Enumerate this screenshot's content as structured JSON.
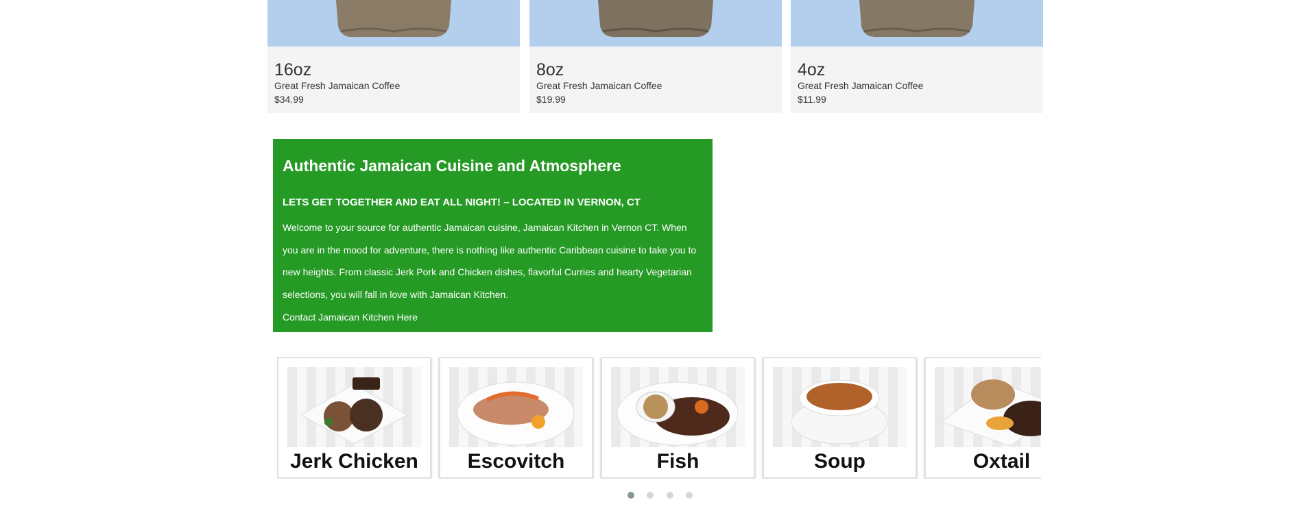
{
  "products": [
    {
      "size": "16oz",
      "description": "Great Fresh Jamaican Coffee",
      "price": "$34.99"
    },
    {
      "size": "8oz",
      "description": "Great Fresh Jamaican Coffee",
      "price": "$19.99"
    },
    {
      "size": "4oz",
      "description": "Great Fresh Jamaican Coffee",
      "price": "$11.99"
    }
  ],
  "about": {
    "title": "Authentic Jamaican Cuisine and Atmosphere",
    "subtitle": "LETS GET TOGETHER AND EAT ALL NIGHT! – LOCATED IN VERNON, CT",
    "body": "Welcome to your source for authentic Jamaican cuisine, Jamaican Kitchen in Vernon CT. When you are in the mood for adventure, there is nothing like authentic Caribbean cuisine to take you to new heights. From classic Jerk Pork and Chicken dishes, flavorful Curries and hearty Vegetarian selections, you will fall in love with Jamaican Kitchen.",
    "contact_link": "Contact Jamaican Kitchen Here"
  },
  "carousel": {
    "items": [
      {
        "label": "Jerk Chicken"
      },
      {
        "label": "Escovitch"
      },
      {
        "label": "Fish"
      },
      {
        "label": "Soup"
      },
      {
        "label": "Oxtail"
      }
    ],
    "pages": 4,
    "active_page": 1
  },
  "colors": {
    "banner_green": "#259a25",
    "product_image_bg": "#b3cfed",
    "dot_active": "#869791",
    "dot_inactive": "#d6d6d6"
  }
}
